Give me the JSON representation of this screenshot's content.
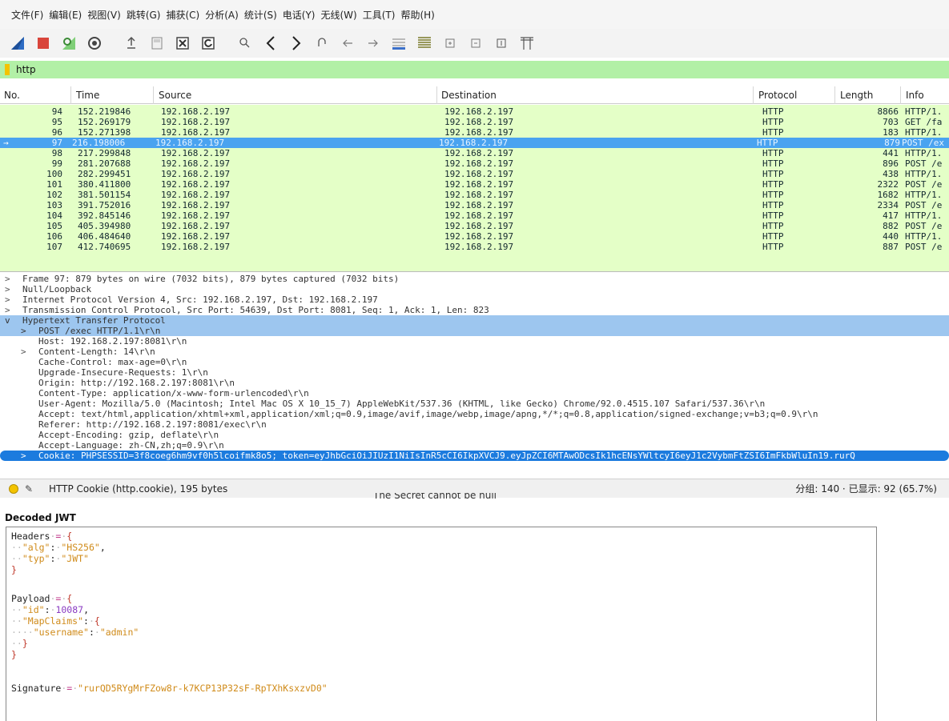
{
  "menu": [
    "文件(F)",
    "编辑(E)",
    "视图(V)",
    "跳转(G)",
    "捕获(C)",
    "分析(A)",
    "统计(S)",
    "电话(Y)",
    "无线(W)",
    "工具(T)",
    "帮助(H)"
  ],
  "toolbar": {
    "icons": [
      "shark-fin-start-icon",
      "stop-capture-icon",
      "restart-capture-icon",
      "capture-options-icon",
      "open-file-icon",
      "save-file-icon",
      "close-file-icon",
      "reload-file-icon",
      "find-packet-icon",
      "go-back-icon",
      "go-forward-icon",
      "go-to-packet-icon",
      "first-packet-icon",
      "last-packet-icon",
      "auto-scroll-icon",
      "colorize-icon",
      "zoom-in-icon",
      "zoom-out-icon",
      "normal-size-icon",
      "resize-columns-icon"
    ]
  },
  "filter": {
    "value": "http"
  },
  "packet_list": {
    "headers": [
      "No.",
      "Time",
      "Source",
      "Destination",
      "Protocol",
      "Length",
      "Info"
    ],
    "rows": [
      {
        "no": "94",
        "time": "152.219846",
        "src": "192.168.2.197",
        "dst": "192.168.2.197",
        "proto": "HTTP",
        "len": "8866",
        "info": "HTTP/1."
      },
      {
        "no": "95",
        "time": "152.269179",
        "src": "192.168.2.197",
        "dst": "192.168.2.197",
        "proto": "HTTP",
        "len": "703",
        "info": "GET /fa"
      },
      {
        "no": "96",
        "time": "152.271398",
        "src": "192.168.2.197",
        "dst": "192.168.2.197",
        "proto": "HTTP",
        "len": "183",
        "info": "HTTP/1."
      },
      {
        "no": "97",
        "time": "216.198006",
        "src": "192.168.2.197",
        "dst": "192.168.2.197",
        "proto": "HTTP",
        "len": "879",
        "info": "POST /ex",
        "selected": true
      },
      {
        "no": "98",
        "time": "217.299848",
        "src": "192.168.2.197",
        "dst": "192.168.2.197",
        "proto": "HTTP",
        "len": "441",
        "info": "HTTP/1."
      },
      {
        "no": "99",
        "time": "281.207688",
        "src": "192.168.2.197",
        "dst": "192.168.2.197",
        "proto": "HTTP",
        "len": "896",
        "info": "POST /e"
      },
      {
        "no": "100",
        "time": "282.299451",
        "src": "192.168.2.197",
        "dst": "192.168.2.197",
        "proto": "HTTP",
        "len": "438",
        "info": "HTTP/1."
      },
      {
        "no": "101",
        "time": "380.411800",
        "src": "192.168.2.197",
        "dst": "192.168.2.197",
        "proto": "HTTP",
        "len": "2322",
        "info": "POST /e"
      },
      {
        "no": "102",
        "time": "381.501154",
        "src": "192.168.2.197",
        "dst": "192.168.2.197",
        "proto": "HTTP",
        "len": "1682",
        "info": "HTTP/1."
      },
      {
        "no": "103",
        "time": "391.752016",
        "src": "192.168.2.197",
        "dst": "192.168.2.197",
        "proto": "HTTP",
        "len": "2334",
        "info": "POST /e"
      },
      {
        "no": "104",
        "time": "392.845146",
        "src": "192.168.2.197",
        "dst": "192.168.2.197",
        "proto": "HTTP",
        "len": "417",
        "info": "HTTP/1."
      },
      {
        "no": "105",
        "time": "405.394980",
        "src": "192.168.2.197",
        "dst": "192.168.2.197",
        "proto": "HTTP",
        "len": "882",
        "info": "POST /e"
      },
      {
        "no": "106",
        "time": "406.484640",
        "src": "192.168.2.197",
        "dst": "192.168.2.197",
        "proto": "HTTP",
        "len": "440",
        "info": "HTTP/1."
      },
      {
        "no": "107",
        "time": "412.740695",
        "src": "192.168.2.197",
        "dst": "192.168.2.197",
        "proto": "HTTP",
        "len": "887",
        "info": "POST /e"
      }
    ]
  },
  "details": [
    {
      "arrow": ">",
      "indent": 0,
      "text": "Frame 97: 879 bytes on wire (7032 bits), 879 bytes captured (7032 bits)"
    },
    {
      "arrow": ">",
      "indent": 0,
      "text": "Null/Loopback"
    },
    {
      "arrow": ">",
      "indent": 0,
      "text": "Internet Protocol Version 4, Src: 192.168.2.197, Dst: 192.168.2.197"
    },
    {
      "arrow": ">",
      "indent": 0,
      "text": "Transmission Control Protocol, Src Port: 54639, Dst Port: 8081, Seq: 1, Ack: 1, Len: 823"
    },
    {
      "arrow": "v",
      "indent": 0,
      "text": "Hypertext Transfer Protocol",
      "style": "hl"
    },
    {
      "arrow": ">",
      "indent": 1,
      "text": "POST /exec HTTP/1.1\\r\\n",
      "style": "hl"
    },
    {
      "arrow": "",
      "indent": 1,
      "text": "Host: 192.168.2.197:8081\\r\\n"
    },
    {
      "arrow": ">",
      "indent": 1,
      "text": "Content-Length: 14\\r\\n"
    },
    {
      "arrow": "",
      "indent": 1,
      "text": "Cache-Control: max-age=0\\r\\n"
    },
    {
      "arrow": "",
      "indent": 1,
      "text": "Upgrade-Insecure-Requests: 1\\r\\n"
    },
    {
      "arrow": "",
      "indent": 1,
      "text": "Origin: http://192.168.2.197:8081\\r\\n"
    },
    {
      "arrow": "",
      "indent": 1,
      "text": "Content-Type: application/x-www-form-urlencoded\\r\\n"
    },
    {
      "arrow": "",
      "indent": 1,
      "text": "User-Agent: Mozilla/5.0 (Macintosh; Intel Mac OS X 10_15_7) AppleWebKit/537.36 (KHTML, like Gecko) Chrome/92.0.4515.107 Safari/537.36\\r\\n"
    },
    {
      "arrow": "",
      "indent": 1,
      "text": "Accept: text/html,application/xhtml+xml,application/xml;q=0.9,image/avif,image/webp,image/apng,*/*;q=0.8,application/signed-exchange;v=b3;q=0.9\\r\\n"
    },
    {
      "arrow": "",
      "indent": 1,
      "text": "Referer: http://192.168.2.197:8081/exec\\r\\n"
    },
    {
      "arrow": "",
      "indent": 1,
      "text": "Accept-Encoding: gzip, deflate\\r\\n"
    },
    {
      "arrow": "",
      "indent": 1,
      "text": "Accept-Language: zh-CN,zh;q=0.9\\r\\n"
    },
    {
      "arrow": ">",
      "indent": 1,
      "text": "Cookie: PHPSESSID=3f8coeg6hm9vf0h5lcoifmk8o5; token=eyJhbGciOiJIUzI1NiIsInR5cCI6IkpXVCJ9.eyJpZCI6MTAwODcsIk1hcENsYWltcyI6eyJ1c2VybmFtZSI6ImFkbWluIn19.rurQ",
      "style": "cookie"
    }
  ],
  "status": {
    "field": "HTTP Cookie (http.cookie), 195 bytes",
    "counts": "分组: 140 · 已显示: 92 (65.7%)"
  },
  "secret_note": "The Secret cannot be null",
  "jwt": {
    "title": "Decoded JWT",
    "headers_label": "Headers",
    "alg_key": "\"alg\"",
    "alg_val": "\"HS256\"",
    "typ_key": "\"typ\"",
    "typ_val": "\"JWT\"",
    "payload_label": "Payload",
    "id_key": "\"id\"",
    "id_val": "10087",
    "mapclaims_key": "\"MapClaims\"",
    "username_key": "\"username\"",
    "username_val": "\"admin\"",
    "signature_label": "Signature",
    "signature_val": "\"rurQD5RYgMrFZow8r-k7KCP13P32sF-RpTXhKsxzvD0\""
  },
  "colors": {
    "filter_ok": "#b2f0a6",
    "http_row": "#e4ffc7",
    "selected_row": "#4aa3f0",
    "cookie_highlight": "#1c7bde",
    "jwt_string": "#d08b1a",
    "jwt_number": "#8a3bc2",
    "jwt_brace": "#c0392b"
  }
}
